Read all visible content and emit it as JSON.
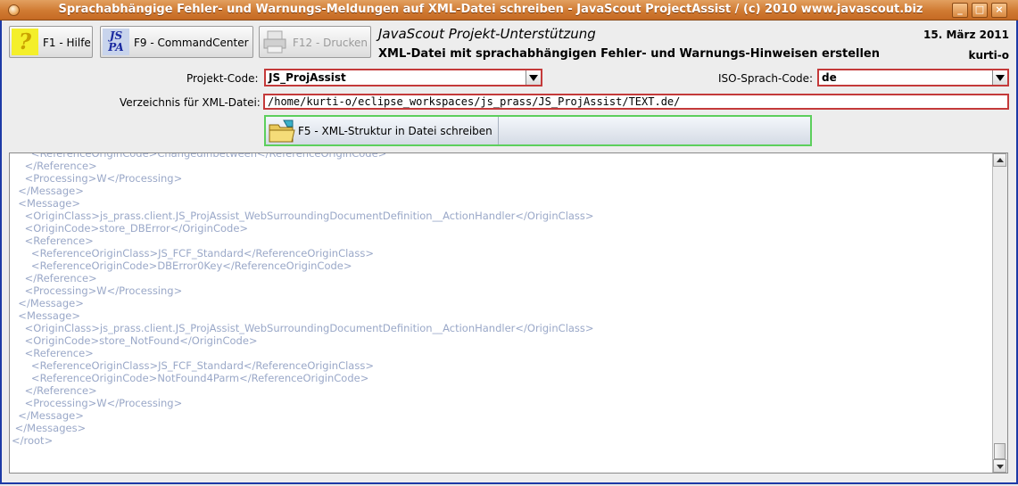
{
  "window": {
    "title": "Sprachabhängige Fehler- und Warnungs-Meldungen auf XML-Datei schreiben - JavaScout ProjectAssist / (c) 2010 www.javascout.biz",
    "accent_color": "#d07a32",
    "border_color": "#1d3aa6"
  },
  "toolbar": {
    "help_label": "F1 - Hilfe",
    "help_icon_glyph": "?",
    "command_center_label": "F9 - CommandCenter",
    "jspa_icon_text_top": "JS",
    "jspa_icon_text_bottom": "PA",
    "print_label": "F12 - Drucken"
  },
  "header": {
    "app_title": "JavaScout Projekt-Unterstützung",
    "subtitle": "XML-Datei mit sprachabhängigen Fehler- und Warnungs-Hinweisen erstellen",
    "date": "15. März 2011",
    "user": "kurti-o"
  },
  "form": {
    "project_code_label": "Projekt-Code:",
    "project_code_value": "JS_ProjAssist",
    "iso_language_label": "ISO-Sprach-Code:",
    "iso_language_value": "de",
    "directory_label": "Verzeichnis für XML-Datei:",
    "directory_value": "/home/kurti-o/eclipse_workspaces/js_prass/JS_ProjAssist/TEXT.de/"
  },
  "action": {
    "write_button_label": "F5 - XML-Struktur in Datei schreiben"
  },
  "xml_output": {
    "lines": [
      "      <ReferenceOriginCode>ChangedInbetween</ReferenceOriginCode>",
      "    </Reference>",
      "    <Processing>W</Processing>",
      "  </Message>",
      "  <Message>",
      "    <OriginClass>js_prass.client.JS_ProjAssist_WebSurroundingDocumentDefinition__ActionHandler</OriginClass>",
      "    <OriginCode>store_DBError</OriginCode>",
      "    <Reference>",
      "      <ReferenceOriginClass>JS_FCF_Standard</ReferenceOriginClass>",
      "      <ReferenceOriginCode>DBError0Key</ReferenceOriginCode>",
      "    </Reference>",
      "    <Processing>W</Processing>",
      "  </Message>",
      "  <Message>",
      "    <OriginClass>js_prass.client.JS_ProjAssist_WebSurroundingDocumentDefinition__ActionHandler</OriginClass>",
      "    <OriginCode>store_NotFound</OriginCode>",
      "    <Reference>",
      "      <ReferenceOriginClass>JS_FCF_Standard</ReferenceOriginClass>",
      "      <ReferenceOriginCode>NotFound4Parm</ReferenceOriginCode>",
      "    </Reference>",
      "    <Processing>W</Processing>",
      "  </Message>",
      " </Messages>",
      "</root>"
    ]
  }
}
